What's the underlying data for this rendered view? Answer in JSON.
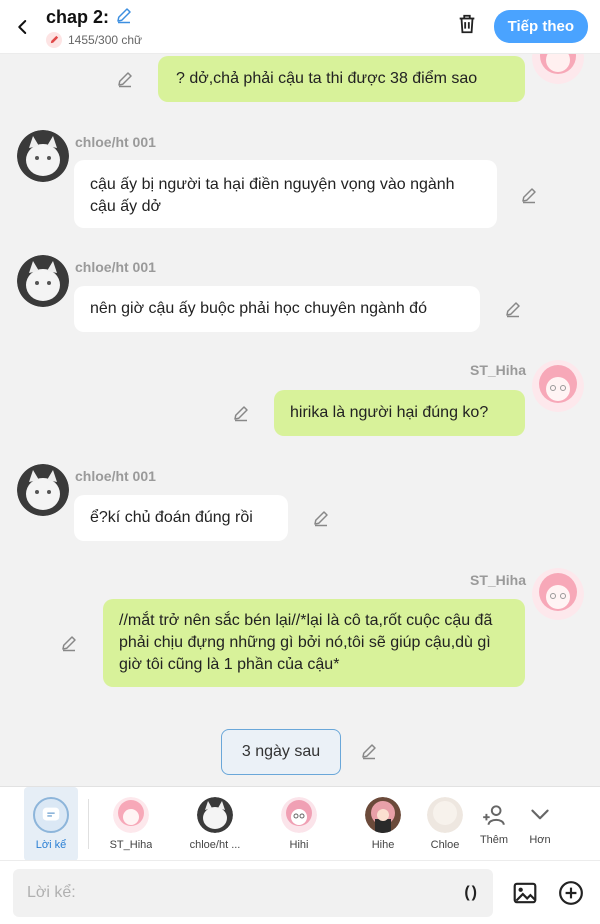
{
  "header": {
    "title": "chap 2:",
    "word_count": "1455/300 chữ",
    "next_label": "Tiếp theo"
  },
  "messages": [
    {
      "side": "right",
      "text": "? dở,chả phải cậu ta thi được 38 điểm sao"
    },
    {
      "side": "left",
      "name": "chloe/ht 001",
      "text": "cậu ấy bị người ta hại điền nguyện vọng vào ngành cậu ấy dở"
    },
    {
      "side": "left",
      "name": "chloe/ht 001",
      "text": "nên giờ cậu ấy buộc phải học chuyên ngành đó"
    },
    {
      "side": "right",
      "name": "ST_Hiha",
      "text": "hirika là người hại đúng ko?"
    },
    {
      "side": "left",
      "name": "chloe/ht 001",
      "text": "ể?kí chủ đoán đúng rồi"
    },
    {
      "side": "right",
      "name": "ST_Hiha",
      "text": "//mắt trở nên sắc bén lại//*lại là cô ta,rốt cuộc cậu đã phải chịu đựng những gì bởi nó,tôi sẽ giúp cậu,dù gì giờ tôi cũng là 1 phần của cậu*"
    }
  ],
  "time_marker": "3 ngày sau",
  "characters": [
    {
      "label": "Lời kể",
      "selected": true
    },
    {
      "label": "ST_Hiha"
    },
    {
      "label": "chloe/ht ..."
    },
    {
      "label": "Hihi"
    },
    {
      "label": "Hihe"
    },
    {
      "label": "Chloe"
    }
  ],
  "extras": {
    "add_label": "Thêm",
    "more_label": "Hơn"
  },
  "input": {
    "placeholder": "Lời kể:",
    "paren": "()"
  },
  "colors": {
    "accent": "#4aa3ff",
    "bubble_right": "#d8f29a",
    "bubble_left": "#ffffff",
    "background": "#f2f2f2"
  }
}
